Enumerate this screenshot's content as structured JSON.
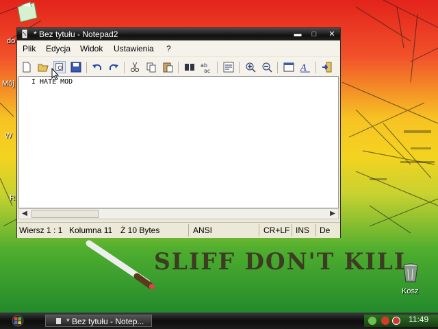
{
  "desktop": {
    "icon_labels": [
      "do",
      "Mój",
      "W",
      "R"
    ],
    "slogan": "SLIFF DON'T KILL",
    "recycle_bin_label": "Kosz"
  },
  "window": {
    "title": "* Bez tytułu - Notepad2",
    "buttons": {
      "minimize": "▬",
      "maximize": "□",
      "close": "✕"
    },
    "menu": [
      "Plik",
      "Edycja",
      "Widok",
      "Ustawienia",
      "?"
    ],
    "toolbar_icons": [
      "new-file-icon",
      "open-folder-icon",
      "browse-icon",
      "save-icon",
      "undo-icon",
      "redo-icon",
      "cut-icon",
      "copy-icon",
      "paste-icon",
      "find-icon",
      "replace-icon",
      "word-wrap-icon",
      "zoom-in-icon",
      "zoom-out-icon",
      "scheme-icon",
      "font-icon",
      "exit-icon"
    ],
    "editor_text": "I HATE MOD",
    "status": {
      "position": "Wiersz 1 : 1",
      "column": "Kolumna 11",
      "size": "Ż 10 Bytes",
      "encoding": "ANSI",
      "line_ending": "CR+LF",
      "insert_mode": "INS",
      "scheme": "De"
    }
  },
  "taskbar": {
    "task_title": "* Bez tytułu - Notep...",
    "clock": "11:49"
  },
  "colors": {
    "title_bar": "#111111",
    "window_bg": "#ece9d8",
    "taskbar": "#1c1c1c",
    "tray": "#2f6d25"
  }
}
